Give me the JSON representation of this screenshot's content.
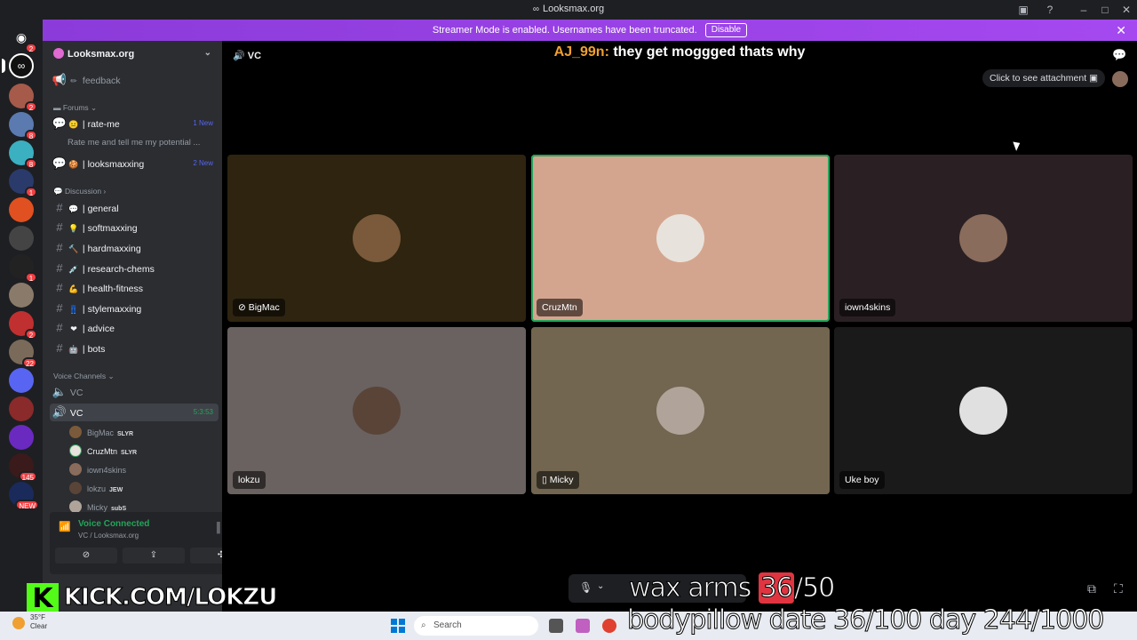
{
  "window": {
    "title": "Looksmax.org"
  },
  "banner": {
    "text": "Streamer Mode is enabled. Usernames have been truncated.",
    "button": "Disable"
  },
  "server_rail": {
    "badges": [
      "2",
      "2",
      "8",
      "8",
      "1",
      "1",
      "2",
      "22",
      "145",
      "NEW"
    ]
  },
  "guild": {
    "name": "Looksmax.org"
  },
  "channels": {
    "feedback": "feedback",
    "forums_cat": "Forums",
    "rate_me": "| rate-me",
    "rate_me_new": "1 New",
    "rate_me_thread": "Rate me and tell me my potential ...",
    "looksmaxxing": "| looksmaxxing",
    "looksmaxxing_new": "2 New",
    "discussion_cat": "Discussion",
    "general": "| general",
    "softmaxxing": "| softmaxxing",
    "hardmaxxing": "| hardmaxxing",
    "research_chems": "| research-chems",
    "health_fitness": "| health-fitness",
    "stylemaxxing": "| stylemaxxing",
    "advice": "| advice",
    "bots": "| bots",
    "voice_cat": "Voice Channels",
    "vc1": "VC",
    "vc2": "VC",
    "vc2_timer": "5:3:53"
  },
  "members": [
    {
      "name": "BigMac",
      "tag": "SLYR"
    },
    {
      "name": "CruzMtn",
      "tag": "SLYR"
    },
    {
      "name": "iown4skins",
      "tag": ""
    },
    {
      "name": "lokzu",
      "tag": "JEW"
    },
    {
      "name": "Micky",
      "tag": "subS"
    }
  ],
  "voice_panel": {
    "status": "Voice Connected",
    "sub": "VC / Looksmax.org"
  },
  "main": {
    "channel": "VC",
    "chat_author": "AJ_99n:",
    "chat_text": "they get moggged thats why",
    "attachment": "Click to see attachment"
  },
  "tiles": [
    {
      "name": "BigMac",
      "bg": "#2e2410",
      "avatar": "#7a5a3a"
    },
    {
      "name": "CruzMtn",
      "bg": "#d4a58e",
      "avatar": "#e8e2dc"
    },
    {
      "name": "iown4skins",
      "bg": "#2a2024",
      "avatar": "#8a6c5c"
    },
    {
      "name": "lokzu",
      "bg": "#6a6260",
      "avatar": "#5a4438"
    },
    {
      "name": "Micky",
      "bg": "#726650",
      "avatar": "#b0a49a"
    },
    {
      "name": "Uke boy",
      "bg": "#1a1a1a",
      "avatar": "#e0e0e0"
    }
  ],
  "overlay": {
    "kick_letter": "K",
    "kick_url": "KICK.COM/LOKZU",
    "wax_prefix": "wax arms ",
    "wax_hl": "36",
    "wax_suffix": "/50",
    "bottom_text": "bodypillow date 36/100    day 244/1000"
  },
  "taskbar": {
    "temp": "35°F",
    "cond": "Clear",
    "search": "Search"
  }
}
